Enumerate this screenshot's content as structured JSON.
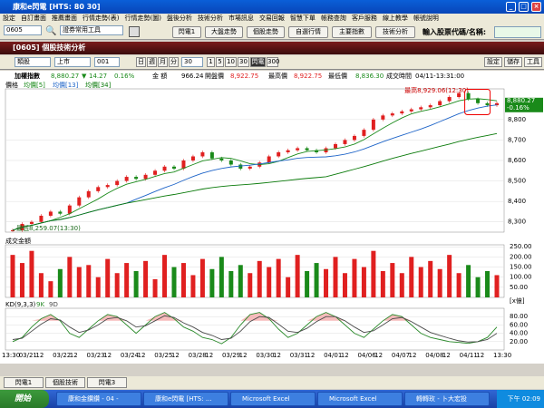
{
  "window": {
    "title": "康和e閃電 [HTS: 80 30]",
    "min": "_",
    "max": "□",
    "close": "×"
  },
  "menu": [
    "設定",
    "自訂畫面",
    "推薦畫面",
    "行情走勢(表)",
    "行情走勢(圖)",
    "盤後分析",
    "技術分析",
    "市場訊息",
    "交易回報",
    "智慧下單",
    "帳務查詢",
    "客戶服務",
    "線上教學",
    "帳號說明"
  ],
  "toolbar": {
    "code": "0605",
    "tool": "證券常用工具",
    "buttons": [
      "閃電1",
      "大盤走勢",
      "個股走勢",
      "自選行情",
      "主要指數",
      "技術分析"
    ],
    "search_label": "輸入股票代碼/名稱:",
    "search_value": ""
  },
  "panel": {
    "title": "[0605] 個股技術分析"
  },
  "controls": {
    "kind": "類股",
    "market": "上市",
    "code": "001",
    "periods": [
      "日",
      "週",
      "月",
      "分"
    ],
    "interval": "30",
    "ticks": [
      "1",
      "5",
      "10",
      "30",
      "閃電",
      "300"
    ],
    "active": "閃電",
    "right_buttons": [
      "設定",
      "儲存",
      "工具"
    ]
  },
  "quote": {
    "name": "加權指數",
    "price": "8,880.27",
    "arrow": "▼",
    "change": "14.27",
    "pct": "0.16%",
    "amount_label": "金 額",
    "amount": "966.24",
    "open_label": "開盤價",
    "open": "8,922.75",
    "high_label": "最高價",
    "high": "8,922.75",
    "low_label": "最低價",
    "low": "8,836.30",
    "time_label": "成交時間",
    "time": "04/11-13:31:00"
  },
  "price_panel": {
    "legend_main": "價格",
    "ma5": "均價[5]",
    "ma13": "均價[13]",
    "ma34": "均價[34]",
    "high_note": "最高8,929.06(12:30)",
    "low_note": "最低8,259.07(13:30)",
    "current": "8,880.27",
    "current_pct": "-0.16%",
    "yticks": [
      "8,800",
      "8,700",
      "8,600",
      "8,500",
      "8,400",
      "8,300"
    ]
  },
  "volume_panel": {
    "legend": "成交金額",
    "yticks": [
      "250.00",
      "200.00",
      "150.00",
      "100.00",
      "50.00"
    ],
    "unit": "[x億]"
  },
  "kd_panel": {
    "legend": "KD(9,3,3)",
    "k": "9K",
    "d": "9D",
    "yticks": [
      "80.00",
      "60.00",
      "40.00",
      "20.00"
    ]
  },
  "xaxis": [
    "13:30",
    "03/21",
    "12",
    "03/22",
    "12",
    "03/23",
    "12",
    "03/24",
    "12",
    "03/25",
    "12",
    "03/28",
    "12",
    "03/29",
    "12",
    "03/30",
    "12",
    "03/31",
    "12",
    "04/01",
    "12",
    "04/06",
    "12",
    "04/07",
    "12",
    "04/08",
    "12",
    "04/11",
    "12",
    "13:30"
  ],
  "colors": {
    "up": "#e02020",
    "down": "#1a8a1a",
    "ma5": "#1a8a1a",
    "ma13": "#1e64c8",
    "ma34": "#0a7a0a",
    "k": "#2a8a2a",
    "d": "#4a4a4a"
  },
  "chart_data": [
    {
      "type": "line",
      "title": "加權指數",
      "series": [
        {
          "name": "價格",
          "values": [
            8259,
            8290,
            8300,
            8330,
            8350,
            8340,
            8380,
            8420,
            8450,
            8470,
            8480,
            8500,
            8520,
            8510,
            8530,
            8550,
            8570,
            8560,
            8600,
            8620,
            8640,
            8610,
            8600,
            8580,
            8560,
            8570,
            8590,
            8620,
            8640,
            8650,
            8660,
            8650,
            8640,
            8660,
            8680,
            8700,
            8720,
            8750,
            8800,
            8820,
            8830,
            8840,
            8850,
            8860,
            8870,
            8890,
            8910,
            8929,
            8900,
            8880,
            8870,
            8880
          ]
        }
      ],
      "ylim": [
        8250,
        8950
      ]
    },
    {
      "type": "bar",
      "title": "成交金額",
      "values": [
        210,
        170,
        230,
        120,
        80,
        140,
        200,
        150,
        160,
        100,
        190,
        120,
        170,
        130,
        180,
        90,
        210,
        150,
        170,
        110,
        190,
        140,
        200,
        130,
        160,
        120,
        180,
        150,
        190,
        100,
        210,
        130,
        170,
        140,
        200,
        120,
        190,
        150,
        230,
        130,
        170,
        120,
        200,
        150,
        180,
        140,
        210,
        120,
        160,
        100,
        130,
        110
      ],
      "ylim": [
        0,
        260
      ]
    },
    {
      "type": "line",
      "title": "KD",
      "series": [
        {
          "name": "9K",
          "values": [
            20,
            30,
            55,
            75,
            85,
            70,
            40,
            30,
            50,
            70,
            85,
            80,
            60,
            40,
            60,
            80,
            90,
            75,
            55,
            45,
            30,
            25,
            15,
            30,
            60,
            85,
            90,
            75,
            50,
            30,
            40,
            60,
            80,
            90,
            80,
            60,
            40,
            30,
            50,
            70,
            85,
            80,
            60,
            40,
            30,
            25,
            20,
            18,
            16,
            20,
            30,
            55
          ]
        },
        {
          "name": "9D",
          "values": [
            25,
            28,
            45,
            62,
            75,
            72,
            55,
            42,
            48,
            60,
            75,
            78,
            70,
            55,
            58,
            70,
            82,
            78,
            65,
            55,
            42,
            35,
            25,
            28,
            45,
            68,
            80,
            78,
            62,
            45,
            42,
            52,
            68,
            80,
            80,
            70,
            55,
            42,
            46,
            60,
            75,
            78,
            68,
            55,
            42,
            35,
            28,
            22,
            19,
            20,
            25,
            40
          ]
        }
      ],
      "ylim": [
        0,
        100
      ]
    }
  ],
  "status_tabs": [
    "閃電1",
    "個股技術",
    "閃電3"
  ],
  "taskbar": {
    "start": "開始",
    "tasks": [
      "康和金鑽鑽 - 04 -",
      "康和e閃電 [HTS: ...",
      "Microsoft Excel",
      "Microsoft Excel",
      "轉轉玫 - 卜大宏投"
    ],
    "clock": "下午 02:09"
  }
}
